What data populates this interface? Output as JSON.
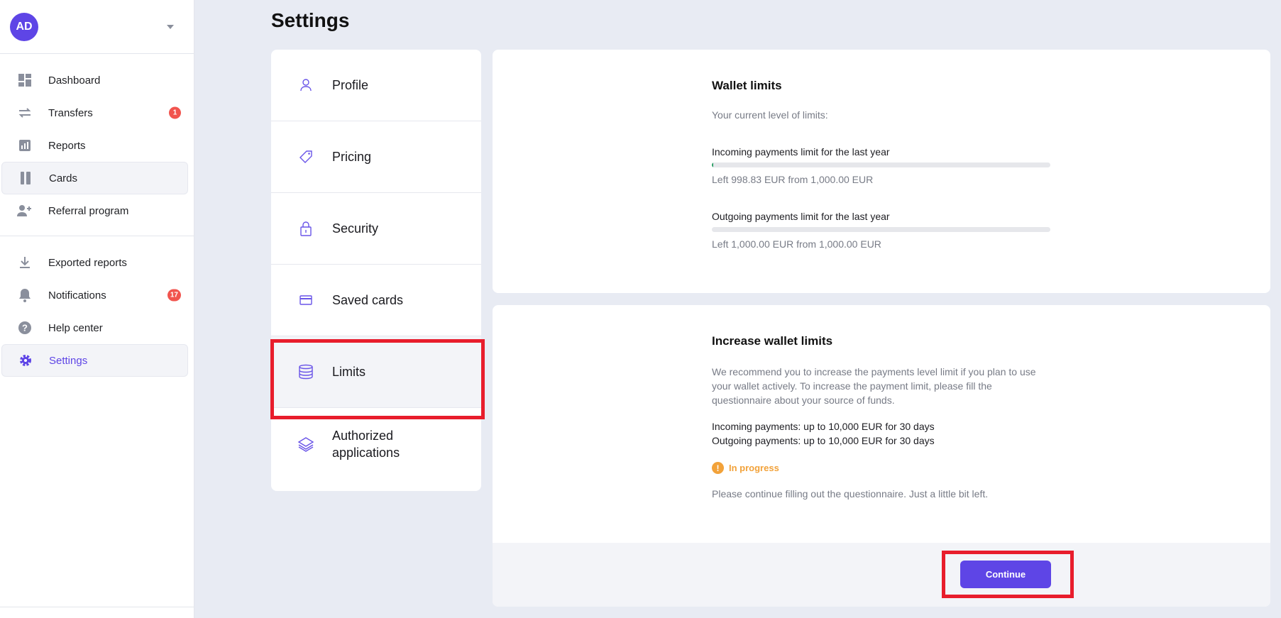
{
  "user": {
    "initials": "AD"
  },
  "sidebar": {
    "primary": [
      {
        "label": "Dashboard",
        "icon": "dashboard-icon"
      },
      {
        "label": "Transfers",
        "icon": "transfers-icon",
        "badge": "1"
      },
      {
        "label": "Reports",
        "icon": "reports-icon"
      },
      {
        "label": "Cards",
        "icon": "cards-icon"
      },
      {
        "label": "Referral program",
        "icon": "add-user-icon"
      }
    ],
    "secondary": [
      {
        "label": "Exported reports",
        "icon": "download-icon"
      },
      {
        "label": "Notifications",
        "icon": "bell-icon",
        "badge": "17"
      },
      {
        "label": "Help center",
        "icon": "help-icon"
      },
      {
        "label": "Settings",
        "icon": "gear-icon"
      }
    ]
  },
  "page": {
    "title": "Settings"
  },
  "settings_menu": [
    {
      "label": "Profile",
      "icon": "user-icon"
    },
    {
      "label": "Pricing",
      "icon": "tag-icon"
    },
    {
      "label": "Security",
      "icon": "lock-icon"
    },
    {
      "label": "Saved cards",
      "icon": "credit-card-icon"
    },
    {
      "label": "Limits",
      "icon": "database-icon",
      "selected": true
    },
    {
      "label": "Authorized applications",
      "icon": "layers-icon"
    }
  ],
  "wallet_limits": {
    "title": "Wallet limits",
    "subtitle": "Your current level of limits:",
    "incoming": {
      "label": "Incoming payments limit for the last year",
      "left_text": "Left 998.83 EUR from 1,000.00 EUR",
      "used_fraction": 0.0012
    },
    "outgoing": {
      "label": "Outgoing payments limit for the last year",
      "left_text": "Left 1,000.00 EUR from 1,000.00 EUR",
      "used_fraction": 0
    }
  },
  "increase_limits": {
    "title": "Increase wallet limits",
    "description": "We recommend you to increase the payments level limit if you plan to use your wallet actively. To increase the payment limit, please fill the questionnaire about your source of funds.",
    "incoming_line": "Incoming payments: up to 10,000 EUR for 30 days",
    "outgoing_line": "Outgoing payments: up to 10,000 EUR for 30 days",
    "status": "In progress",
    "status_color": "#f2a23a",
    "note": "Please continue filling out the questionnaire. Just a little bit left.",
    "button": "Continue"
  },
  "colors": {
    "accent": "#5e45e6",
    "badge": "#f1544e",
    "highlight": "#e81d2c"
  }
}
